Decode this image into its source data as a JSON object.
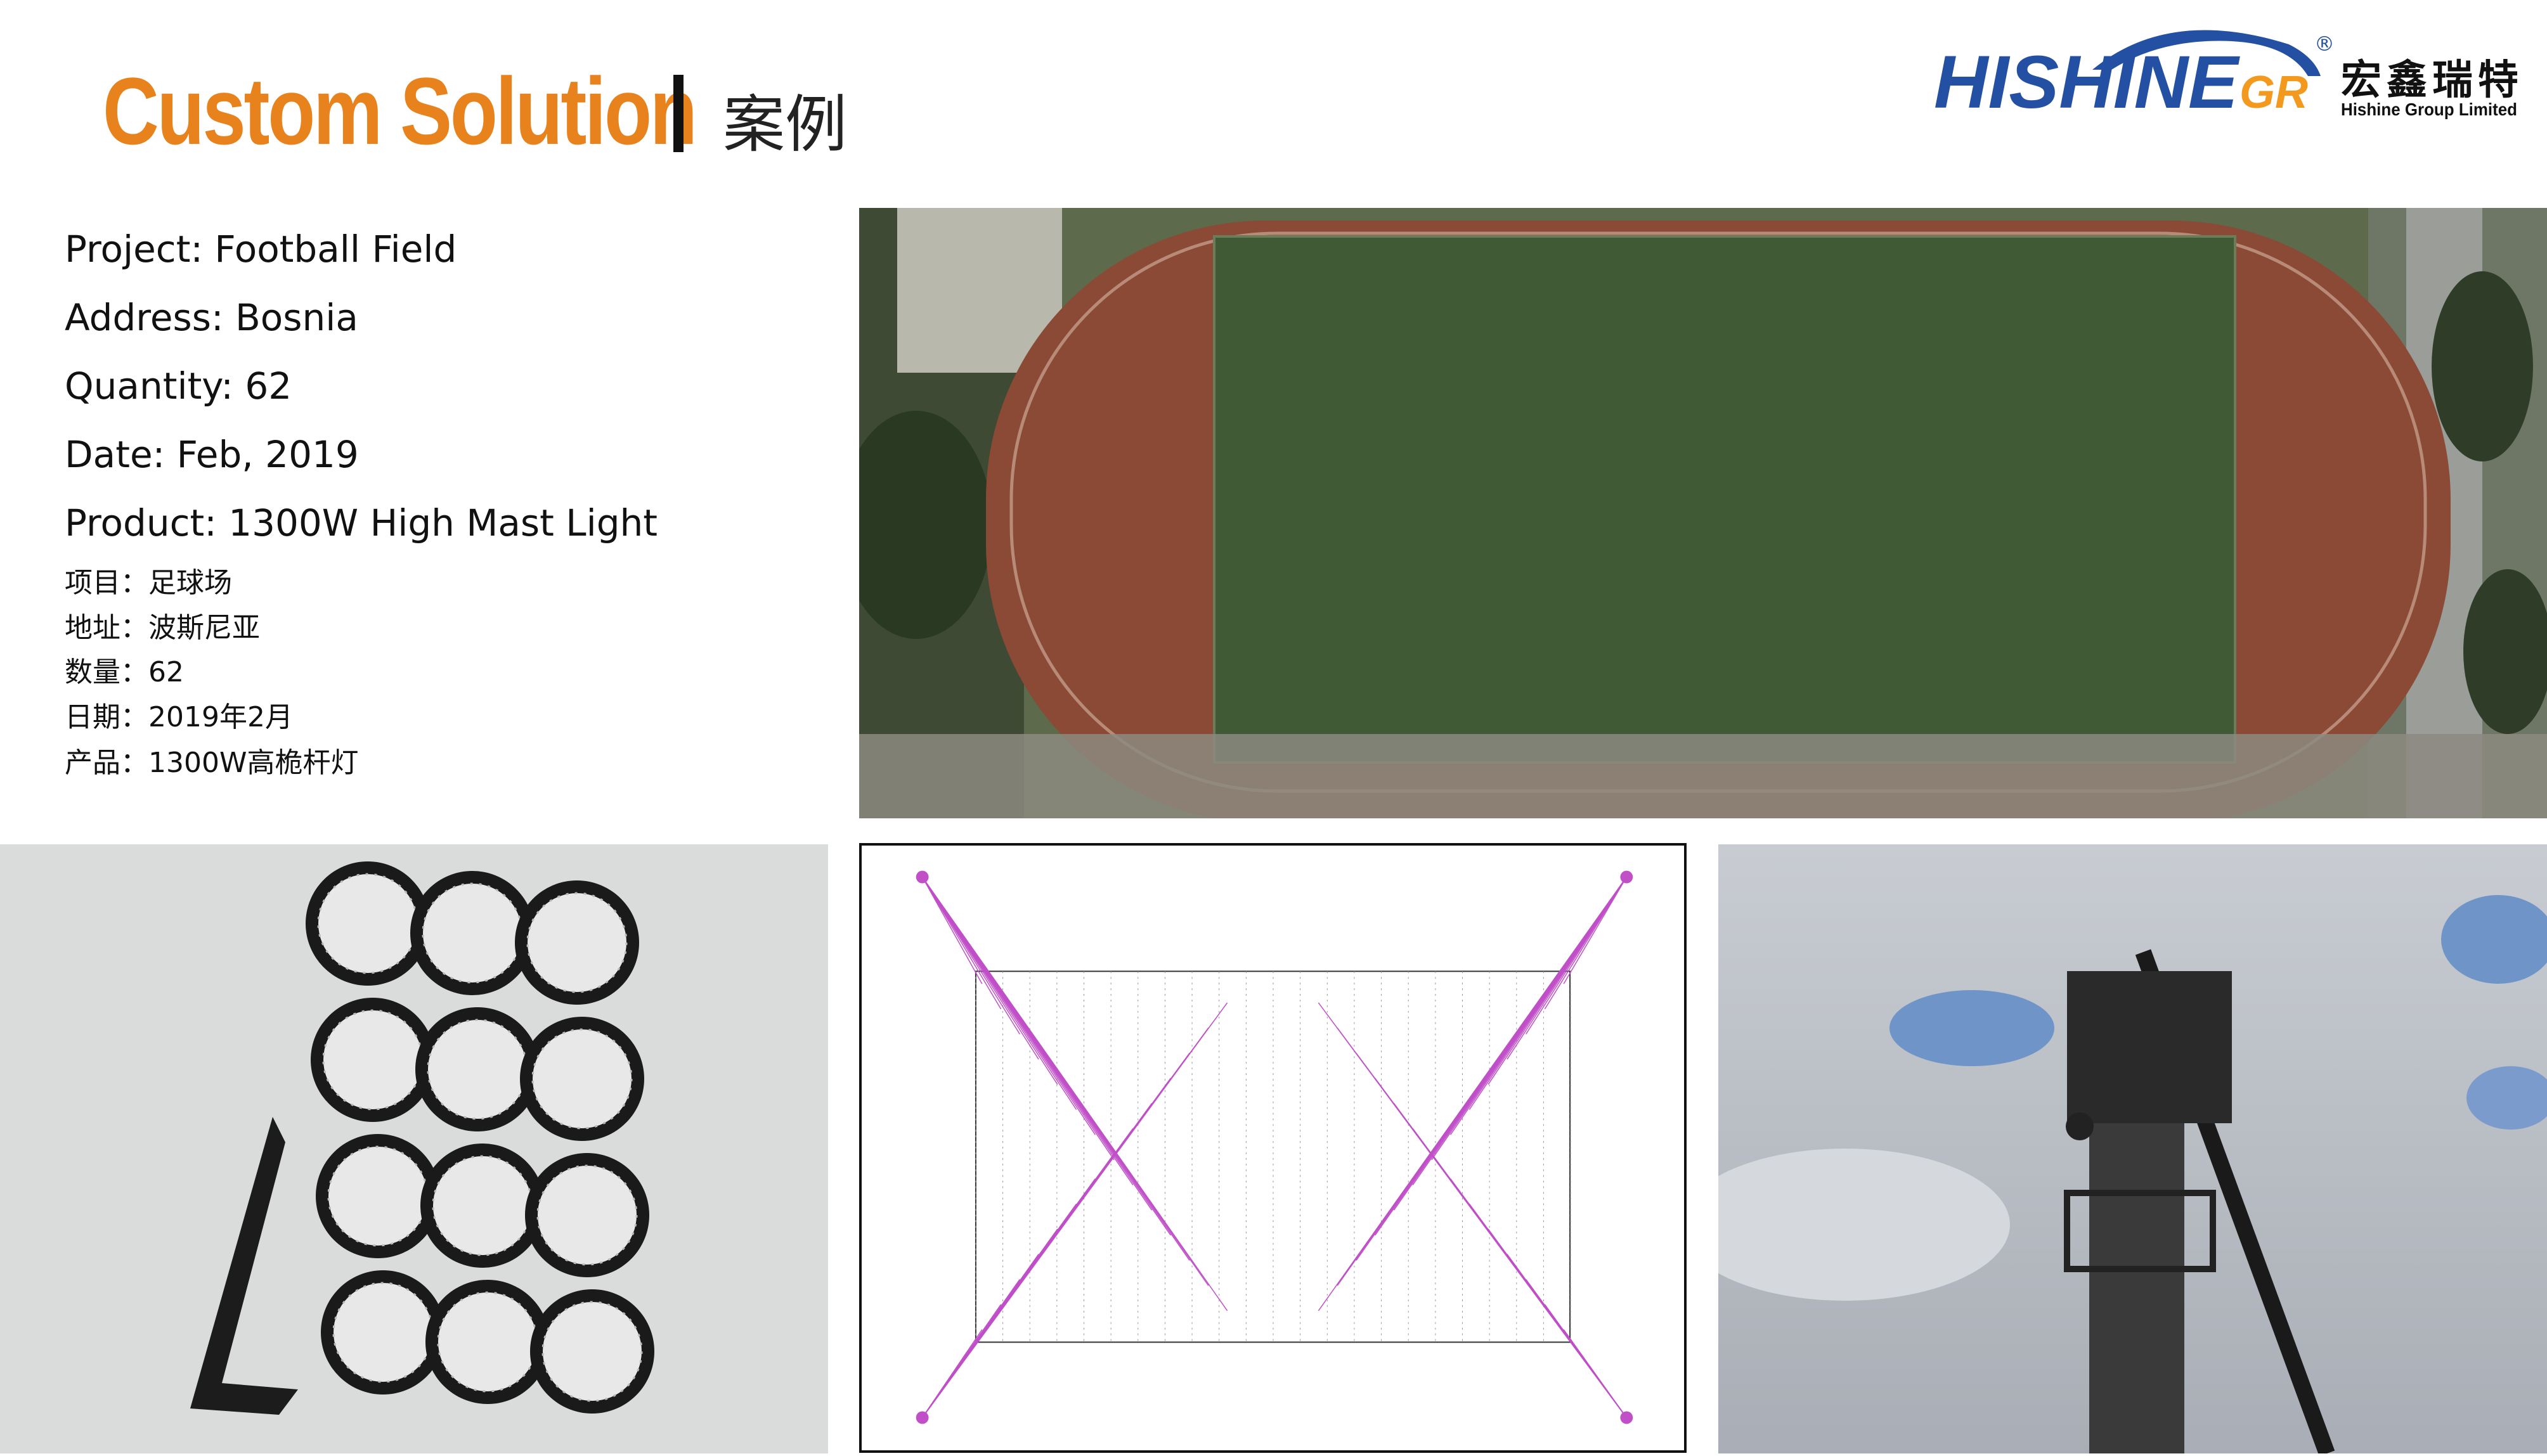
{
  "header": {
    "title": "Custom Solution",
    "title_cn": "案例"
  },
  "logo": {
    "brand": "HISHINE",
    "brand_suffix": "GR",
    "registered_mark": "®",
    "name_cn": "宏鑫瑞特",
    "company": "Hishine Group Limited",
    "colors": {
      "blue": "#2450a4",
      "orange": "#f39a1e"
    }
  },
  "project_info": {
    "en": [
      "Project: Football Field",
      "Address: Bosnia",
      "Quantity: 62",
      "Date: Feb, 2019",
      "Product: 1300W High Mast Light"
    ],
    "cn": [
      "项目：足球场",
      "地址：波斯尼亚",
      "数量：62",
      "日期：2019年2月",
      "产品：1300W高桅杆灯"
    ]
  },
  "images": {
    "aerial": "aerial-football-field-photo",
    "fixture": "led-floodlight-fixture-image",
    "diagram": "lighting-illuminance-layout-diagram",
    "installation": "high-mast-installation-photo"
  },
  "colors": {
    "accent": "#e8821c",
    "diagram_lines": "#c04fc8"
  }
}
